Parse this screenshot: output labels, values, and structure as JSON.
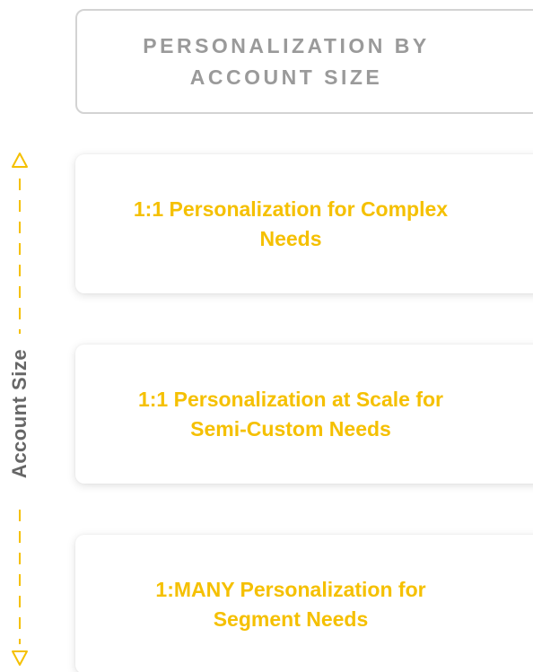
{
  "header": {
    "title": "PERSONALIZATION BY ACCOUNT SIZE"
  },
  "tiers": [
    {
      "label": "1:1 Personalization for Complex Needs"
    },
    {
      "label": "1:1 Personalization at Scale for Semi-Custom Needs"
    },
    {
      "label": "1:MANY Personalization for Segment Needs"
    }
  ],
  "axis": {
    "label": "Account Size",
    "top_icon": "triangle-up-outline-icon",
    "bottom_icon": "triangle-down-outline-icon",
    "line_style": "dashed",
    "color": "#f5c000"
  },
  "colors": {
    "accent": "#f5c000",
    "header_text": "#9a9a9a",
    "axis_text": "#666666",
    "header_border": "#d3d3d3"
  }
}
